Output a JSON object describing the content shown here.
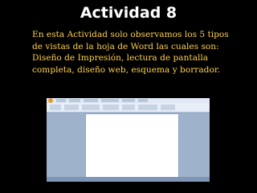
{
  "slide": {
    "title": "Actividad 8",
    "body": "En esta Actividad solo observamos los 5 tipos\nde vistas de la hoja de Word las cuales son:\nDiseño de Impresión, lectura de pantalla\ncompleta, diseño web, esquema y borrador."
  },
  "colors": {
    "background": "#000000",
    "title": "#ffffff",
    "body": "#ffd24a"
  },
  "screenshot": {
    "subject": "Microsoft Word window with ribbon and blank page"
  }
}
